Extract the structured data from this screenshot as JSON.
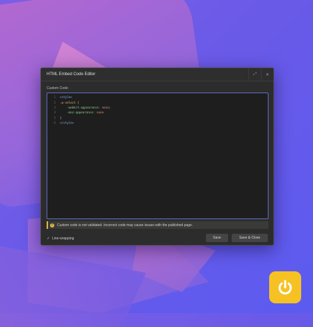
{
  "dialog": {
    "title": "HTML Embed Code Editor",
    "expand_icon": "⤢",
    "close_icon": "✕",
    "field_label": "Custom Code:",
    "code_lines": [
      {
        "num": "1",
        "tokens": [
          {
            "t": "<style>",
            "c": "tag"
          }
        ]
      },
      {
        "num": "2",
        "tokens": [
          {
            "t": ".w-select {",
            "c": "sel"
          }
        ]
      },
      {
        "num": "3",
        "tokens": [
          {
            "t": "    -webkit-appearance: ",
            "c": "prop"
          },
          {
            "t": "none",
            "c": "val"
          },
          {
            "t": ";",
            "c": "punc"
          }
        ]
      },
      {
        "num": "4",
        "tokens": [
          {
            "t": "    -moz-appearance: ",
            "c": "prop"
          },
          {
            "t": "none",
            "c": "val"
          }
        ]
      },
      {
        "num": "5",
        "tokens": [
          {
            "t": "}",
            "c": "punc"
          }
        ]
      },
      {
        "num": "6",
        "tokens": [
          {
            "t": "</style>",
            "c": "tag"
          }
        ]
      }
    ],
    "warning_text": "Custom code is not validated. Incorrect code may cause issues with the published page.",
    "linewrap_label": "Line-wrapping",
    "linewrap_checked": true,
    "save_label": "Save",
    "save_close_label": "Save & Close"
  },
  "colors": {
    "accent": "#5e6fc9",
    "warning": "#e0b84a",
    "logo": "#f6c223"
  },
  "logo": {
    "icon": "power-icon"
  }
}
